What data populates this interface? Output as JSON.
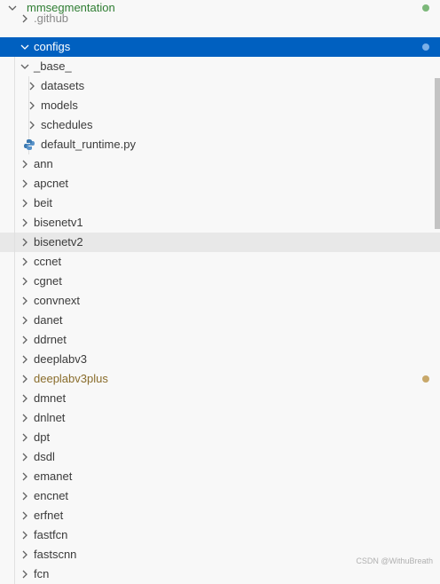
{
  "explorer": {
    "items": [
      {
        "label": "mmsegmentation",
        "depth": 0,
        "expanded": true,
        "color": "green",
        "dot": "#7cb87a"
      },
      {
        "label": ".github",
        "depth": 1,
        "expanded": false,
        "partial": true
      },
      {
        "label": "configs",
        "depth": 1,
        "expanded": true,
        "selected": true,
        "dot": "#7ab0e8"
      },
      {
        "label": "_base_",
        "depth": 2,
        "expanded": true
      },
      {
        "label": "datasets",
        "depth": 3,
        "expanded": false
      },
      {
        "label": "models",
        "depth": 3,
        "expanded": false
      },
      {
        "label": "schedules",
        "depth": 3,
        "expanded": false
      },
      {
        "label": "default_runtime.py",
        "depth": 3,
        "file": true,
        "icon": "python-icon"
      },
      {
        "label": "ann",
        "depth": 2,
        "expanded": false
      },
      {
        "label": "apcnet",
        "depth": 2,
        "expanded": false
      },
      {
        "label": "beit",
        "depth": 2,
        "expanded": false
      },
      {
        "label": "bisenetv1",
        "depth": 2,
        "expanded": false
      },
      {
        "label": "bisenetv2",
        "depth": 2,
        "expanded": false,
        "hover": true
      },
      {
        "label": "ccnet",
        "depth": 2,
        "expanded": false
      },
      {
        "label": "cgnet",
        "depth": 2,
        "expanded": false
      },
      {
        "label": "convnext",
        "depth": 2,
        "expanded": false
      },
      {
        "label": "danet",
        "depth": 2,
        "expanded": false
      },
      {
        "label": "ddrnet",
        "depth": 2,
        "expanded": false
      },
      {
        "label": "deeplabv3",
        "depth": 2,
        "expanded": false
      },
      {
        "label": "deeplabv3plus",
        "depth": 2,
        "expanded": false,
        "color": "yellow",
        "dot": "#c8a86a"
      },
      {
        "label": "dmnet",
        "depth": 2,
        "expanded": false
      },
      {
        "label": "dnlnet",
        "depth": 2,
        "expanded": false
      },
      {
        "label": "dpt",
        "depth": 2,
        "expanded": false
      },
      {
        "label": "dsdl",
        "depth": 2,
        "expanded": false
      },
      {
        "label": "emanet",
        "depth": 2,
        "expanded": false
      },
      {
        "label": "encnet",
        "depth": 2,
        "expanded": false
      },
      {
        "label": "erfnet",
        "depth": 2,
        "expanded": false
      },
      {
        "label": "fastfcn",
        "depth": 2,
        "expanded": false
      },
      {
        "label": "fastscnn",
        "depth": 2,
        "expanded": false
      },
      {
        "label": "fcn",
        "depth": 2,
        "expanded": false
      }
    ]
  },
  "watermark": "CSDN @WithuBreath"
}
